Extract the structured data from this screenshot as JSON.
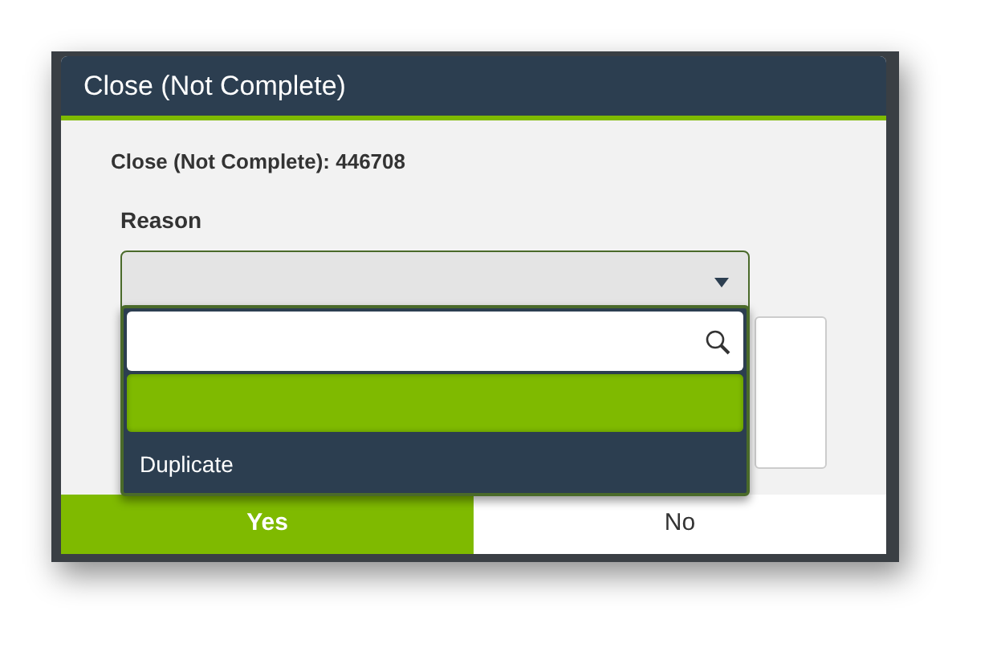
{
  "dialog": {
    "title": "Close (Not Complete)",
    "subtitle": "Close (Not Complete): 446708",
    "reason": {
      "label": "Reason",
      "expanded": true,
      "options": [
        {
          "selected": true
        },
        {
          "label": "Duplicate",
          "selected": false
        }
      ]
    },
    "buttons": [
      {
        "label": "Yes",
        "primary": true
      },
      {
        "label": "No",
        "primary": false
      }
    ]
  }
}
